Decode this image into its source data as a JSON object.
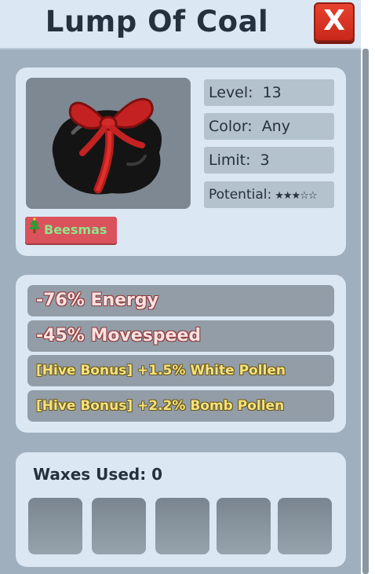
{
  "header": {
    "title": "Lump Of Coal",
    "close_label": "X"
  },
  "item": {
    "image_icon": "coal-with-red-bow",
    "tag": {
      "icon": "christmas-tree-icon",
      "label": "Beesmas"
    },
    "stats": [
      {
        "label": "Level:",
        "value": "13"
      },
      {
        "label": "Color:",
        "value": "Any"
      },
      {
        "label": "Limit:",
        "value": "3"
      },
      {
        "label": "Potential:",
        "value": "★★★☆☆",
        "rating": 3,
        "max": 5
      }
    ]
  },
  "effects": [
    {
      "text": "-76% Energy",
      "color": "#fde2e2"
    },
    {
      "text": "-45% Movespeed",
      "color": "#fde2e2"
    },
    {
      "text": "[Hive Bonus] +1.5% White Pollen",
      "color": "#f7e27a"
    },
    {
      "text": "[Hive Bonus] +2.2% Bomb Pollen",
      "color": "#f7e27a"
    }
  ],
  "waxes": {
    "label": "Waxes Used: 0",
    "slots": 5
  },
  "colors": {
    "panel": "#dbe8f3",
    "background": "#9fafbe",
    "close": "#d9331f",
    "tag": "#d9525c"
  }
}
